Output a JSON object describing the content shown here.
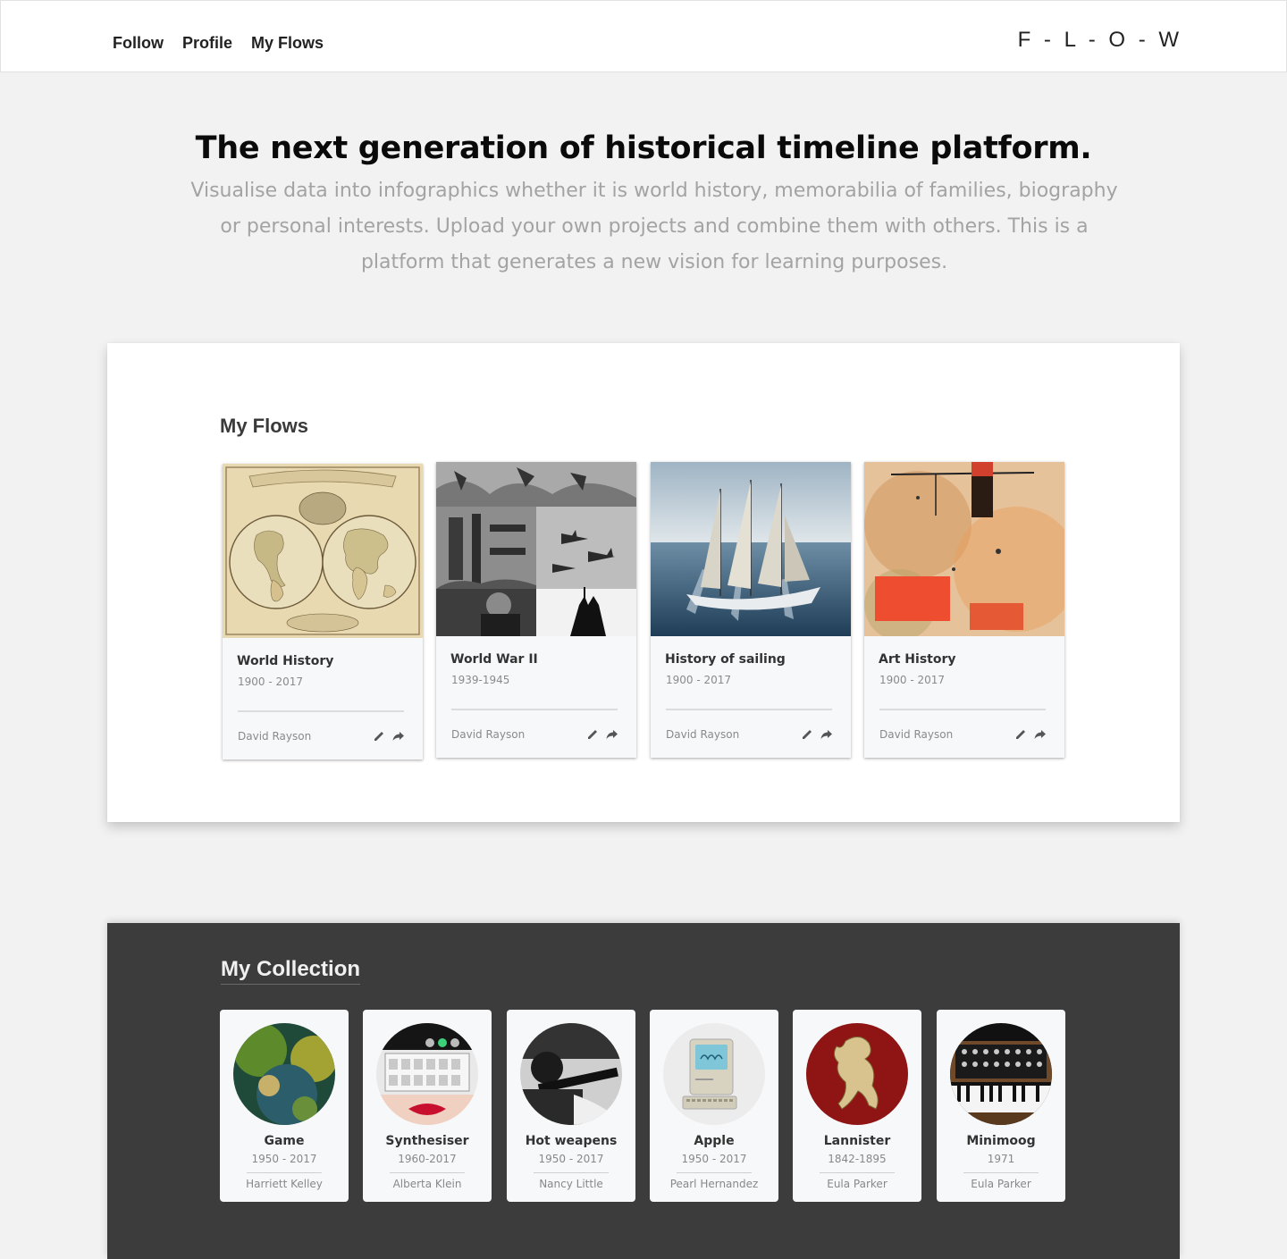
{
  "nav": {
    "items": [
      {
        "label": "Follow"
      },
      {
        "label": "Profile"
      },
      {
        "label": "My Flows"
      }
    ],
    "logo": "F - L - O - W"
  },
  "hero": {
    "title": "The next generation of historical timeline platform.",
    "subtitle": "Visualise data into infographics whether it is world history, memorabilia of families, biography or personal interests. Upload your own projects and combine them with others. This is a platform that generates a new vision for learning purposes."
  },
  "flows": {
    "title": "My Flows",
    "cards": [
      {
        "name": "World History",
        "years": "1900 - 2017",
        "author": "David Rayson",
        "image": "world-map-image"
      },
      {
        "name": "World War II",
        "years": "1939-1945",
        "author": "David Rayson",
        "image": "war-collage-image"
      },
      {
        "name": "History of sailing",
        "years": "1900 - 2017",
        "author": "David Rayson",
        "image": "sailing-ship-image"
      },
      {
        "name": "Art History",
        "years": "1900 - 2017",
        "author": "David Rayson",
        "image": "abstract-painting-image"
      }
    ],
    "icons": [
      "pencil-icon",
      "share-arrow-icon"
    ]
  },
  "collection": {
    "title": "My Collection",
    "cards": [
      {
        "name": "Game",
        "years": "1950 - 2017",
        "author": "Harriett Kelley",
        "image": "game-scene-image"
      },
      {
        "name": "Synthesiser",
        "years": "1960-2017",
        "author": "Alberta Klein",
        "image": "synthesiser-image"
      },
      {
        "name": "Hot weapens",
        "years": "1950 - 2017",
        "author": "Nancy Little",
        "image": "weapons-image"
      },
      {
        "name": "Apple",
        "years": "1950 - 2017",
        "author": "Pearl Hernandez",
        "image": "macintosh-image"
      },
      {
        "name": "Lannister",
        "years": "1842-1895",
        "author": "Eula Parker",
        "image": "lion-crest-image"
      },
      {
        "name": "Minimoog",
        "years": "1971",
        "author": "Eula Parker",
        "image": "minimoog-image"
      }
    ]
  },
  "colors": {
    "page_bg": "#f2f2f2",
    "collection_bg": "#3c3c3d",
    "card_bg": "#f7f8f9",
    "subtitle": "#a3a3a3"
  }
}
